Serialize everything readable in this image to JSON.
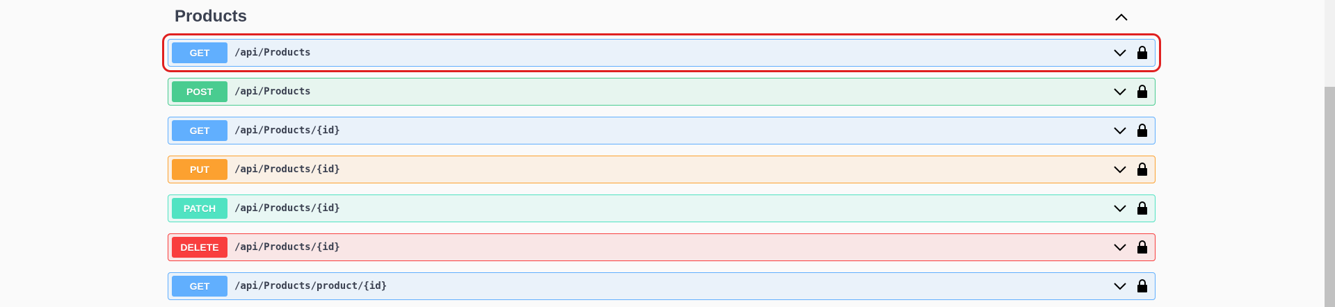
{
  "section": {
    "title": "Products"
  },
  "operations": [
    {
      "method": "GET",
      "path": "/api/Products",
      "highlighted": true
    },
    {
      "method": "POST",
      "path": "/api/Products"
    },
    {
      "method": "GET",
      "path": "/api/Products/{id}"
    },
    {
      "method": "PUT",
      "path": "/api/Products/{id}"
    },
    {
      "method": "PATCH",
      "path": "/api/Products/{id}"
    },
    {
      "method": "DELETE",
      "path": "/api/Products/{id}"
    },
    {
      "method": "GET",
      "path": "/api/Products/product/{id}"
    }
  ],
  "icons": {
    "section_toggle": "chevron-up-icon",
    "op_toggle": "chevron-down-icon",
    "auth": "lock-icon"
  },
  "colors": {
    "get": "#61affe",
    "post": "#49cc90",
    "put": "#fca130",
    "patch": "#50e3c2",
    "delete": "#f93e3e",
    "highlight": "#e02020"
  }
}
